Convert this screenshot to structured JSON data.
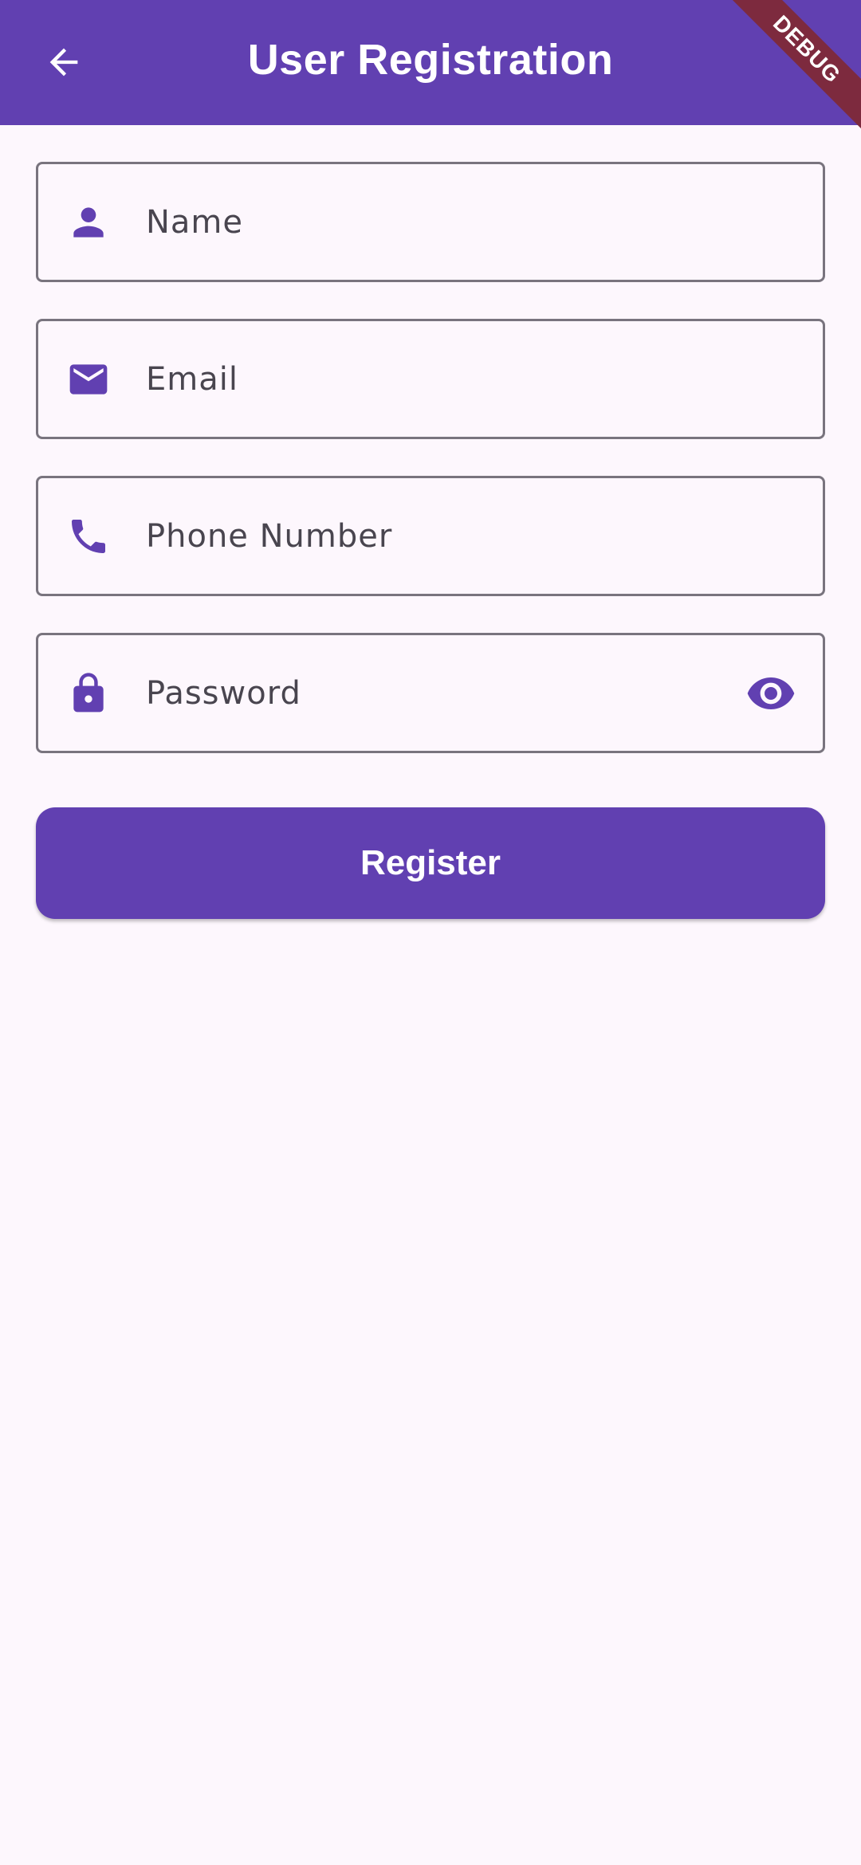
{
  "appbar": {
    "title": "User Registration",
    "back_icon": "arrow-back-icon",
    "background": "#6140b1"
  },
  "debug_banner": {
    "label": "DEBUG",
    "color": "#7d2a3e"
  },
  "form": {
    "fields": [
      {
        "label": "Name",
        "icon": "person-icon"
      },
      {
        "label": "Email",
        "icon": "mail-icon"
      },
      {
        "label": "Phone Number",
        "icon": "phone-icon"
      },
      {
        "label": "Password",
        "icon": "lock-icon",
        "suffix_icon": "visibility-eye-icon"
      }
    ],
    "accent": "#6140b1"
  },
  "register_button": {
    "label": "Register"
  }
}
